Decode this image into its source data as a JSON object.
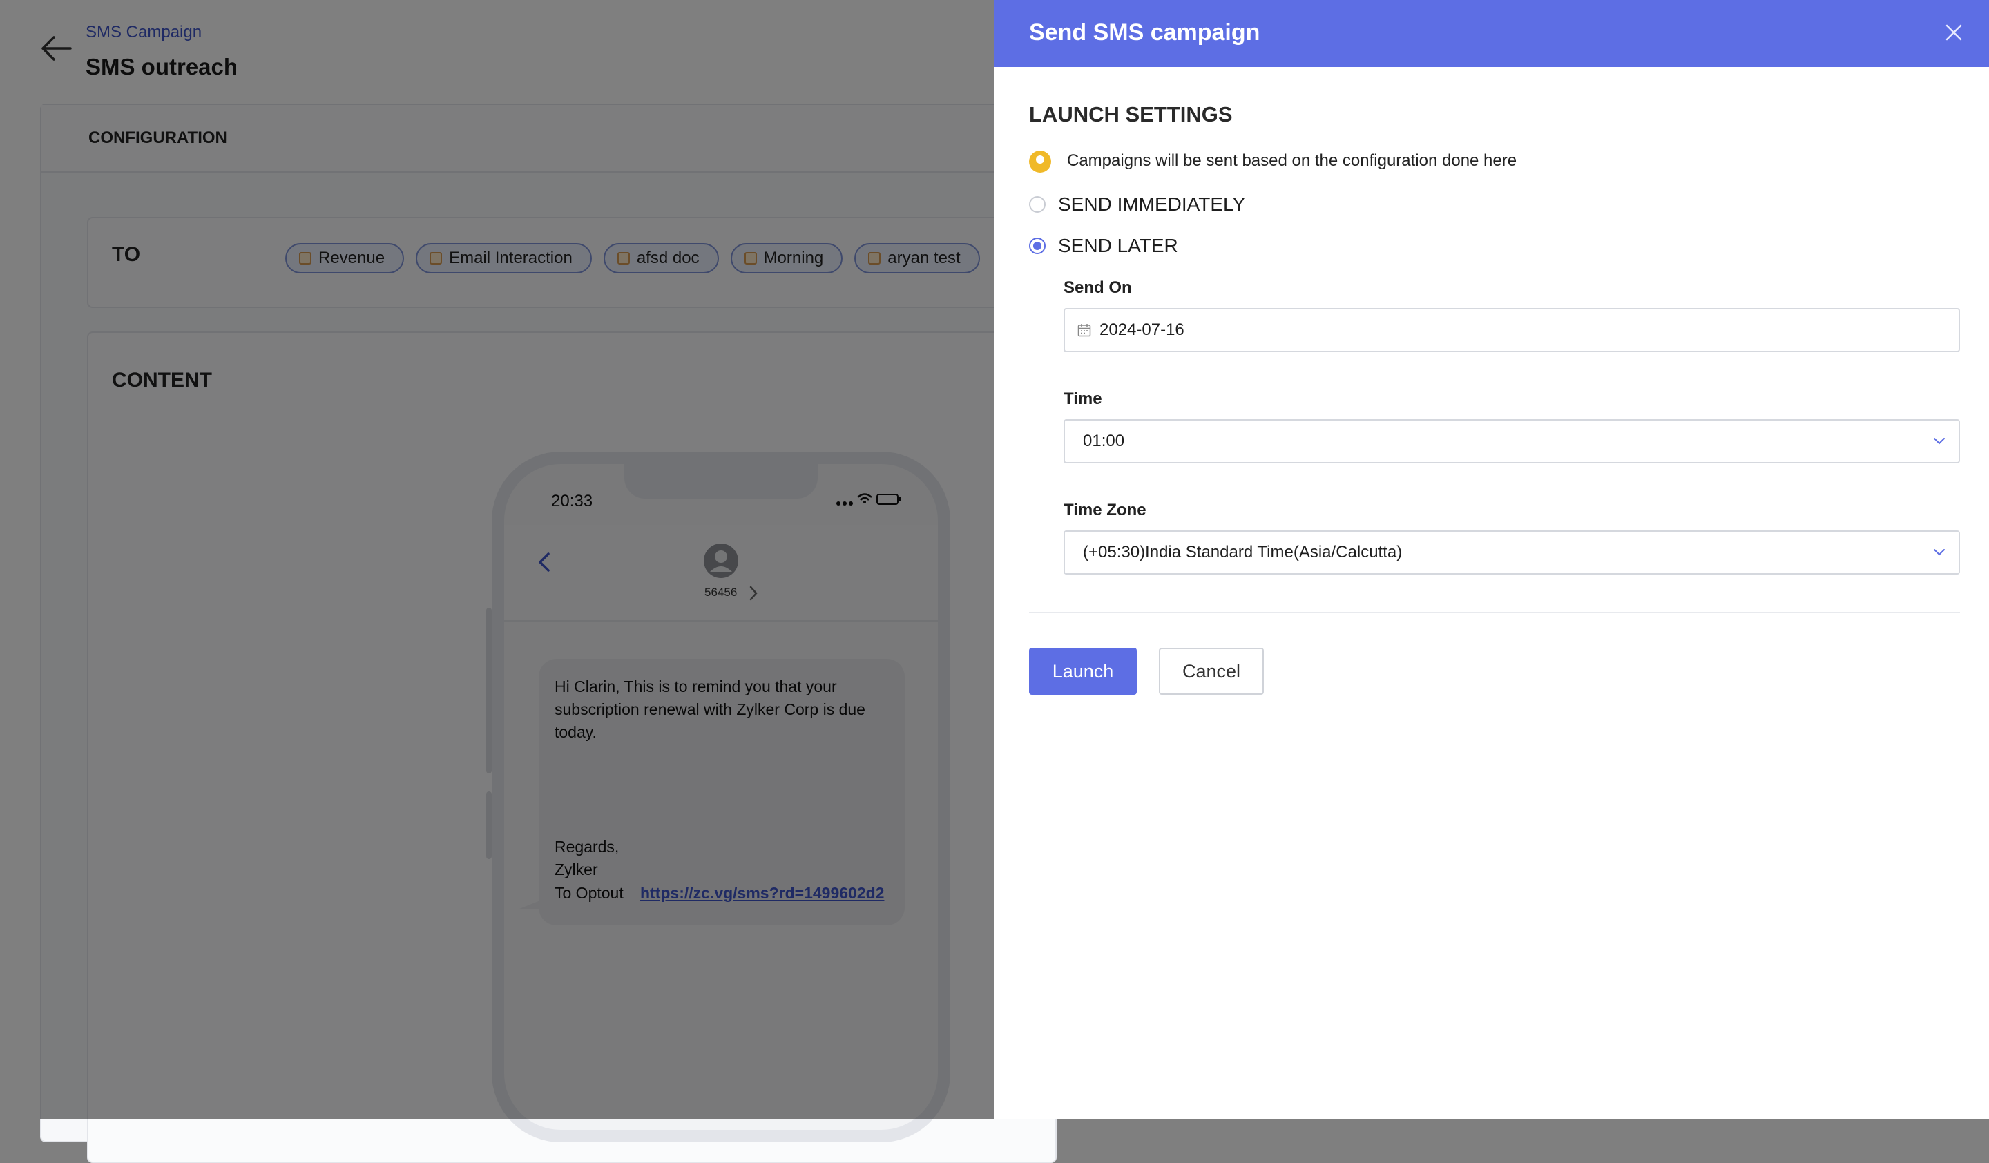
{
  "background": {
    "breadcrumb": "SMS Campaign",
    "page_title": "SMS outreach",
    "config_title": "CONFIGURATION",
    "to_label": "TO",
    "recipient_lists": [
      "Revenue",
      "Email Interaction",
      "afsd doc",
      "Morning",
      "aryan test"
    ],
    "content_label": "CONTENT",
    "phone": {
      "time": "20:33",
      "contact_number": "56456",
      "message": "Hi Clarin, This is to remind you that your subscription renewal with Zylker Corp is due today.",
      "regards_line1": "Regards,",
      "regards_line2": "Zylker",
      "optout_label": "To Optout",
      "optout_link": "https://zc.vg/sms?rd=1499602d2"
    }
  },
  "panel": {
    "title": "Send SMS campaign",
    "section_title": "LAUNCH SETTINGS",
    "info_text": "Campaigns will be sent based on the configuration done here",
    "options": {
      "send_immediately": "SEND IMMEDIATELY",
      "send_later": "SEND LATER",
      "selected": "send_later"
    },
    "send_on": {
      "label": "Send On",
      "value": "2024-07-16"
    },
    "time": {
      "label": "Time",
      "value": "01:00"
    },
    "time_zone": {
      "label": "Time Zone",
      "value": "(+05:30)India Standard Time(Asia/Calcutta)"
    },
    "launch_label": "Launch",
    "cancel_label": "Cancel"
  },
  "colors": {
    "accent": "#5d6ee4",
    "info": "#f0b929",
    "link": "#3f55c9"
  }
}
